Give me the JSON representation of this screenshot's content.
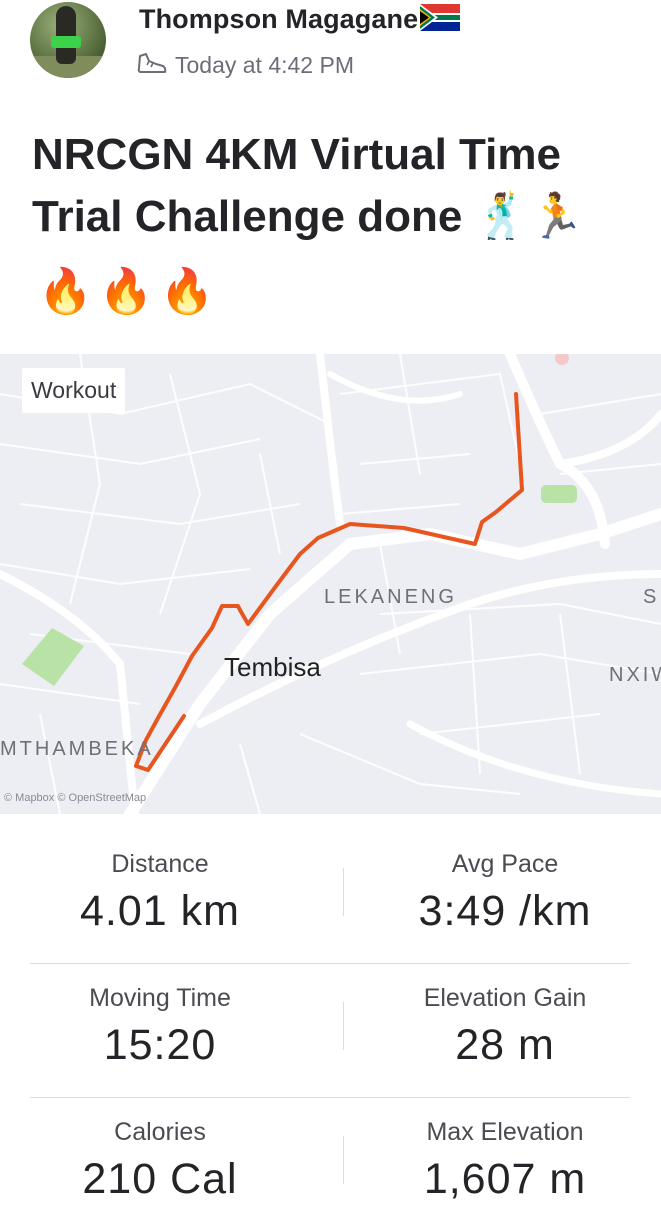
{
  "athlete": {
    "name": "Thompson Magagane",
    "timestamp": "Today at 4:42 PM"
  },
  "activity": {
    "title": "NRCGN 4KM Virtual Time Trial Challenge done",
    "title_emoji": "🕺🏃",
    "emoji_line": "🔥🔥🔥"
  },
  "map": {
    "badge": "Workout",
    "labels": {
      "lekaneng": "LEKANENG",
      "tembisa": "Tembisa",
      "mthambeka": "MTHAMBEKA",
      "nxiw": "NXIW",
      "s": "S"
    },
    "attribution": "© Mapbox © OpenStreetMap",
    "route_color": "#e8561f"
  },
  "stats": [
    {
      "label": "Distance",
      "value": "4.01 km"
    },
    {
      "label": "Avg Pace",
      "value": "3:49 /km"
    },
    {
      "label": "Moving Time",
      "value": "15:20"
    },
    {
      "label": "Elevation Gain",
      "value": "28 m"
    },
    {
      "label": "Calories",
      "value": "210 Cal"
    },
    {
      "label": "Max Elevation",
      "value": "1,607 m"
    }
  ]
}
